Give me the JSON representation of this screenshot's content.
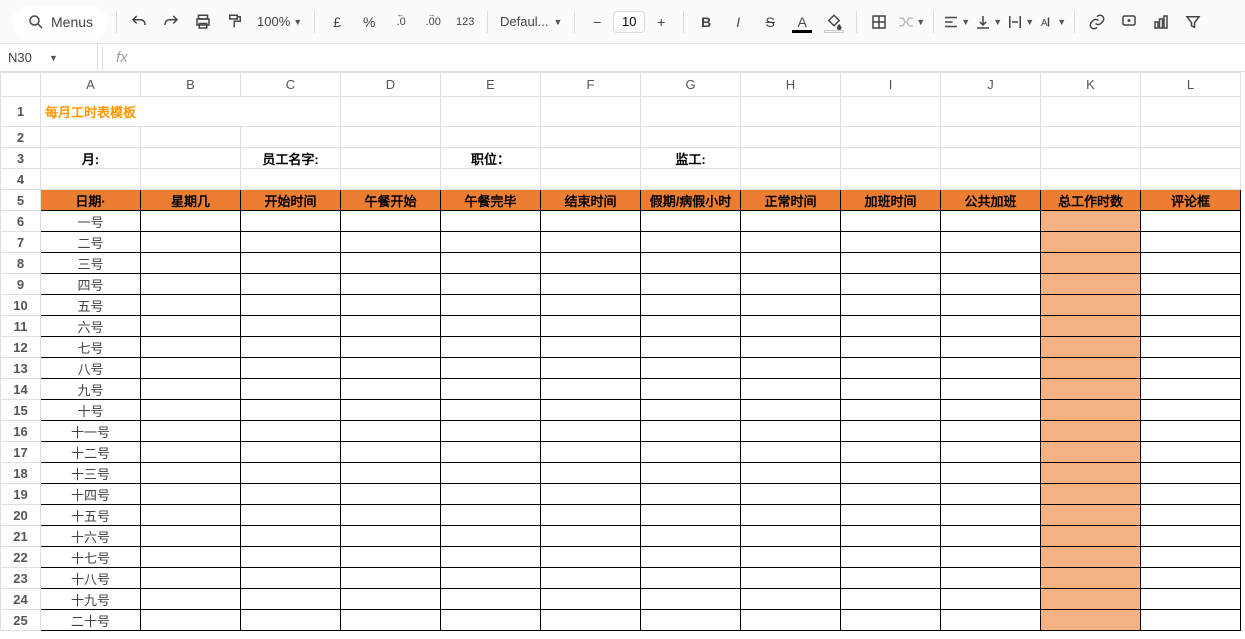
{
  "toolbar": {
    "menus_label": "Menus",
    "zoom": "100%",
    "currency_symbol": "£",
    "percent_symbol": "%",
    "dec_dec": ".0",
    "inc_dec": ".00",
    "format123": "123",
    "font_name": "Defaul...",
    "font_size": "10",
    "bold": "B",
    "italic": "I",
    "strike": "S",
    "text_color_letter": "A",
    "text_color_underline": "#000000",
    "fill_underline": "#ffffff"
  },
  "name_box": "N30",
  "fx_label": "fx",
  "columns": [
    "A",
    "B",
    "C",
    "D",
    "E",
    "F",
    "G",
    "H",
    "I",
    "J",
    "K",
    "L"
  ],
  "sheet": {
    "title": "每月工时表模板",
    "labels": {
      "month": "月:",
      "employee": "员工名字:",
      "position": "职位：",
      "supervisor": "监工:"
    },
    "headers": [
      "日期·",
      "星期几",
      "开始时间",
      "午餐开始",
      "午餐完毕",
      "结束时间",
      "假期/病假小时",
      "正常时间",
      "加班时间",
      "公共加班",
      "总工作时数",
      "评论框"
    ],
    "dates": [
      "一号",
      "二号",
      "三号",
      "四号",
      "五号",
      "六号",
      "七号",
      "八号",
      "九号",
      "十号",
      "十一号",
      "十二号",
      "十三号",
      "十四号",
      "十五号",
      "十六号",
      "十七号",
      "十八号",
      "十九号",
      "二十号"
    ]
  }
}
